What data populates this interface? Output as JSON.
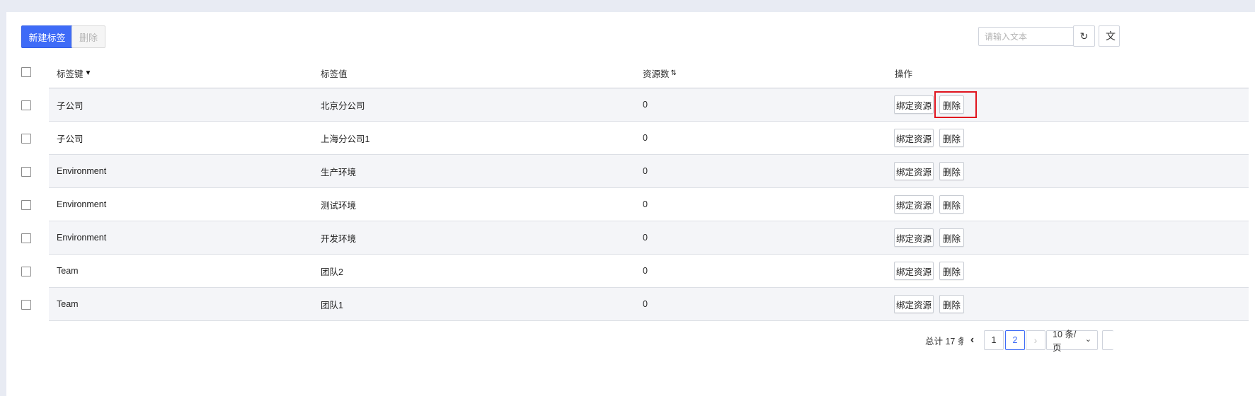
{
  "toolbar": {
    "create_label": "新建标签",
    "delete_label": "删除",
    "search_placeholder": "请输入文本",
    "refresh_icon": "↻",
    "cut_off_label": "文"
  },
  "table": {
    "columns": [
      "标签键",
      "标签值",
      "资源数",
      "操作"
    ],
    "filter_icon": "▼",
    "sort_icon": "⇅",
    "rows": [
      {
        "key": "子公司",
        "value": "北京分公司",
        "count": "0"
      },
      {
        "key": "子公司",
        "value": "上海分公司1",
        "count": "0"
      },
      {
        "key": "Environment",
        "value": "生产环境",
        "count": "0"
      },
      {
        "key": "Environment",
        "value": "测试环境",
        "count": "0"
      },
      {
        "key": "Environment",
        "value": "开发环境",
        "count": "0"
      },
      {
        "key": "Team",
        "value": "团队2",
        "count": "0"
      },
      {
        "key": "Team",
        "value": "团队1",
        "count": "0"
      }
    ],
    "bind_label": "绑定资源",
    "row_delete_label": "删除"
  },
  "pagination": {
    "total": "总计 17 条",
    "prev": "‹",
    "pages": [
      "1",
      "2"
    ],
    "current_page": "2",
    "next": "›",
    "page_size": "10 条/页",
    "caret": "⌄"
  },
  "colors": {
    "primary": "#3e6bf7",
    "highlight": "#e0141e"
  }
}
